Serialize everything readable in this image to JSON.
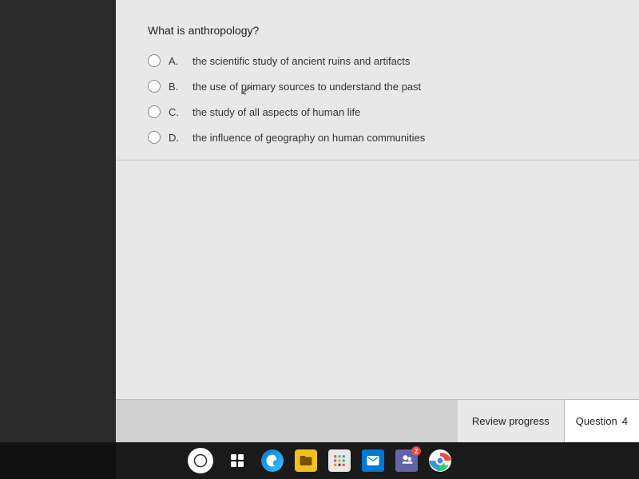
{
  "question": {
    "text": "What is anthropology?",
    "options": [
      {
        "id": "A",
        "text": "the scientific study of ancient ruins and artifacts"
      },
      {
        "id": "B",
        "text": "the use of primary sources to understand the past"
      },
      {
        "id": "C",
        "text": "the study of all aspects of human life"
      },
      {
        "id": "D",
        "text": "the influence of geography on human communities"
      }
    ]
  },
  "footer": {
    "review_progress_label": "Review progress",
    "question_label": "Question",
    "question_number": "4"
  },
  "taskbar": {
    "search_icon": "○",
    "apps_label": "apps-icon",
    "edge_label": "edge-icon",
    "files_label": "files-icon",
    "grid_label": "grid-icon",
    "mail_label": "mail-icon",
    "teams_label": "teams-icon",
    "chrome_label": "chrome-icon"
  }
}
